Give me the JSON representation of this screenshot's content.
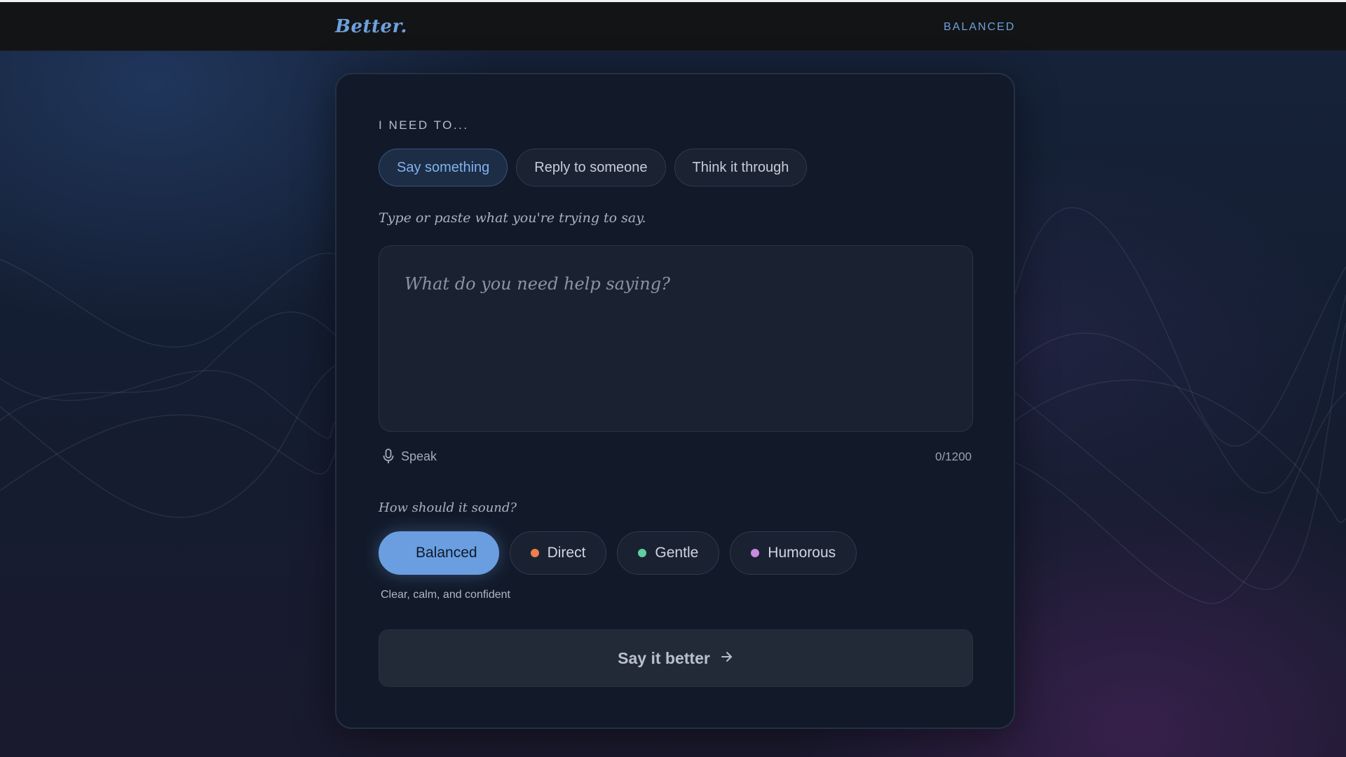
{
  "app": {
    "logo": "Better.",
    "mode_label": "BALANCED"
  },
  "composer": {
    "section_label": "I NEED TO...",
    "modes": [
      {
        "label": "Say something",
        "active": true
      },
      {
        "label": "Reply to someone",
        "active": false
      },
      {
        "label": "Think it through",
        "active": false
      }
    ],
    "hint": "Type or paste what you're trying to say.",
    "placeholder": "What do you need help saying?",
    "speak_label": "Speak",
    "speak_icon": "microphone-icon",
    "counter": "0/1200"
  },
  "tone": {
    "question": "How should it sound?",
    "options": [
      {
        "label": "Balanced",
        "active": true,
        "color": "#6a9ee0"
      },
      {
        "label": "Direct",
        "active": false,
        "color": "#ee7f4e"
      },
      {
        "label": "Gentle",
        "active": false,
        "color": "#5fcfa1"
      },
      {
        "label": "Humorous",
        "active": false,
        "color": "#c98be0"
      }
    ],
    "description": "Clear, calm, and confident"
  },
  "submit": {
    "label": "Say it better",
    "icon": "arrow-right-icon"
  },
  "colors": {
    "accent": "#6ea0dc",
    "background": "#121a2a"
  }
}
